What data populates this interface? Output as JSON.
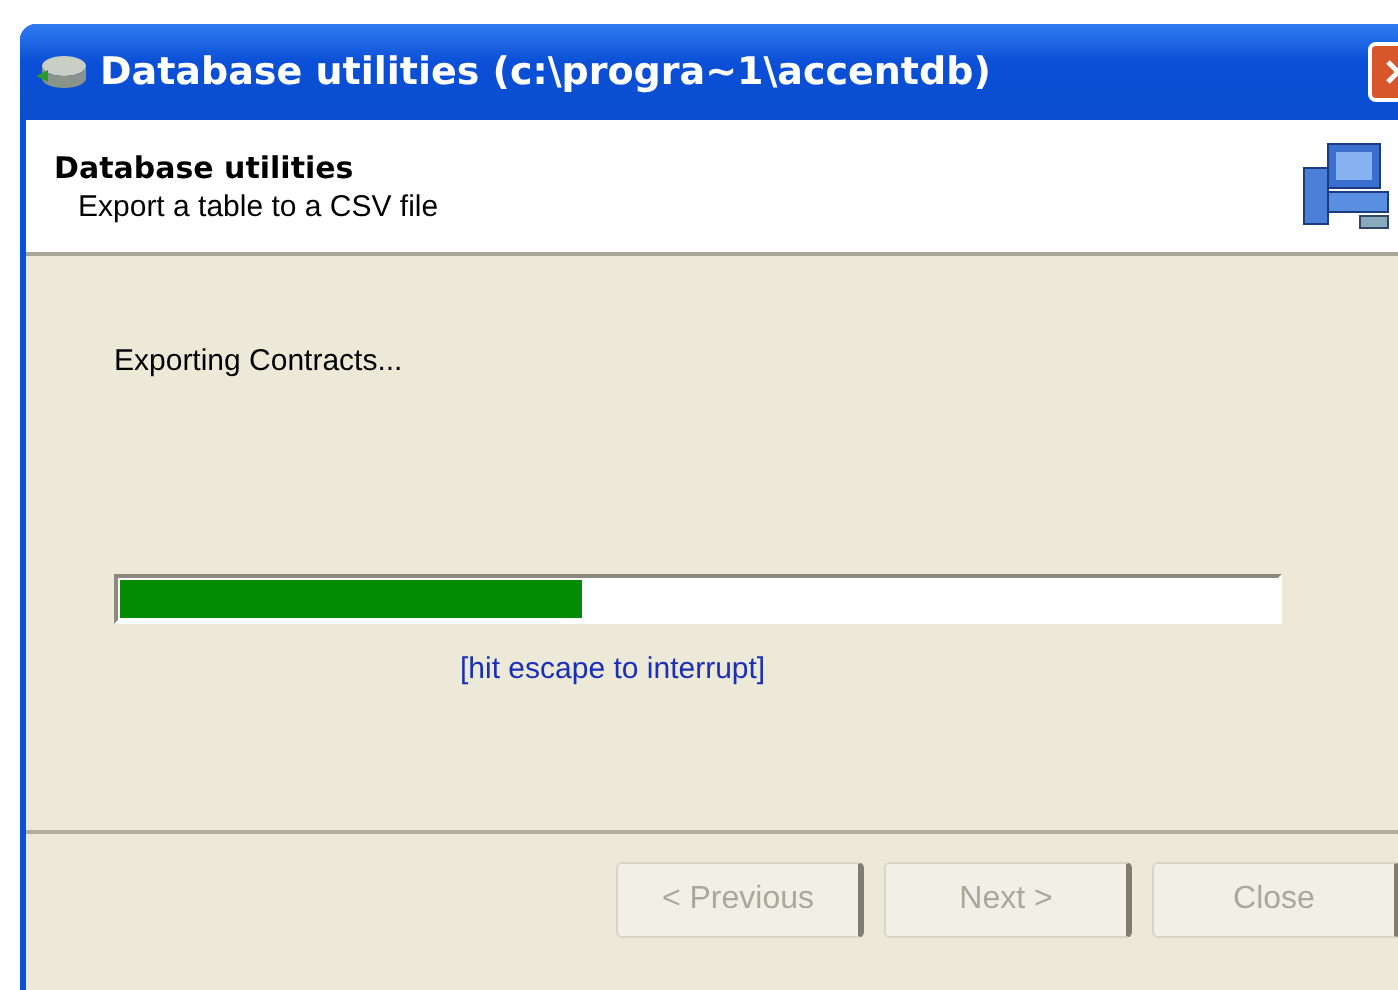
{
  "window": {
    "title": "Database utilities (c:\\progra~1\\accentdb)"
  },
  "header": {
    "title": "Database utilities",
    "subtitle": "Export a table to a CSV file"
  },
  "status": "Exporting Contracts...",
  "progress": {
    "level": 0.4
  },
  "hint": "[hit escape to interrupt]",
  "buttons": [
    {
      "label": "< Previous",
      "disabled": true
    },
    {
      "label": "Next >",
      "disabled": true
    },
    {
      "label": "Close",
      "disabled": true
    }
  ]
}
